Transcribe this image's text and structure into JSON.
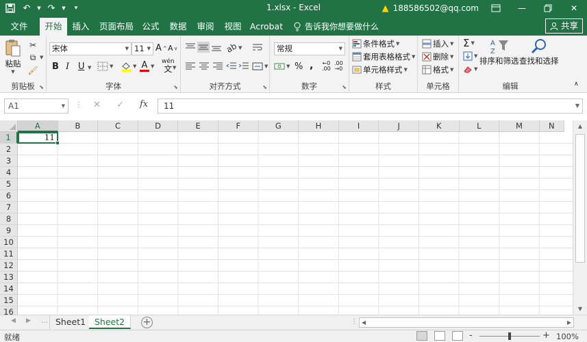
{
  "window": {
    "title": "1.xlsx - Excel",
    "account": "188586502@qq.com",
    "share_label": "共享",
    "qat": {
      "save_icon": "save-icon",
      "undo_icon": "undo-icon",
      "redo_icon": "redo-icon",
      "customize_icon": "customize-icon"
    },
    "controls": {
      "ribbon_options": "ribbon-display-options-icon",
      "minimize": "minimize-icon",
      "restore": "restore-icon",
      "close": "close-icon"
    }
  },
  "tabs": [
    {
      "label": "文件",
      "active": false
    },
    {
      "label": "开始",
      "active": true
    },
    {
      "label": "插入",
      "active": false
    },
    {
      "label": "页面布局",
      "active": false
    },
    {
      "label": "公式",
      "active": false
    },
    {
      "label": "数据",
      "active": false
    },
    {
      "label": "审阅",
      "active": false
    },
    {
      "label": "视图",
      "active": false
    },
    {
      "label": "Acrobat",
      "active": false
    }
  ],
  "tell_me": "告诉我你想要做什么",
  "ribbon": {
    "clipboard": {
      "label": "剪贴板",
      "paste": "粘贴"
    },
    "font": {
      "label": "字体",
      "font_name": "宋体",
      "font_size": "11",
      "bold": "B",
      "italic": "I",
      "underline": "U",
      "wen": "wén",
      "wen2": "文"
    },
    "alignment": {
      "label": "对齐方式"
    },
    "number": {
      "label": "数字",
      "format": "常规",
      "percent": "%",
      "comma": ","
    },
    "styles": {
      "label": "样式",
      "conditional": "条件格式",
      "table": "套用表格格式",
      "cell": "单元格样式"
    },
    "cells": {
      "label": "单元格",
      "insert": "插入",
      "delete": "删除",
      "format": "格式"
    },
    "editing": {
      "label": "编辑",
      "sort": "排序和筛选",
      "find": "查找和选择"
    }
  },
  "formula_bar": {
    "name_box": "A1",
    "formula": "11",
    "fx": "fx"
  },
  "columns": [
    "A",
    "B",
    "C",
    "D",
    "E",
    "F",
    "G",
    "H",
    "I",
    "J",
    "K",
    "L",
    "M",
    "N"
  ],
  "rows": [
    "1",
    "2",
    "3",
    "4",
    "5",
    "6",
    "7",
    "8",
    "9",
    "10",
    "11",
    "12",
    "13",
    "14",
    "15",
    "16"
  ],
  "cells": {
    "A1": "11"
  },
  "sheets": [
    {
      "name": "Sheet1",
      "active": false
    },
    {
      "name": "Sheet2",
      "active": true
    }
  ],
  "status": {
    "text": "就绪",
    "zoom": "100%",
    "zoom_minus": "-",
    "zoom_plus": "+"
  }
}
